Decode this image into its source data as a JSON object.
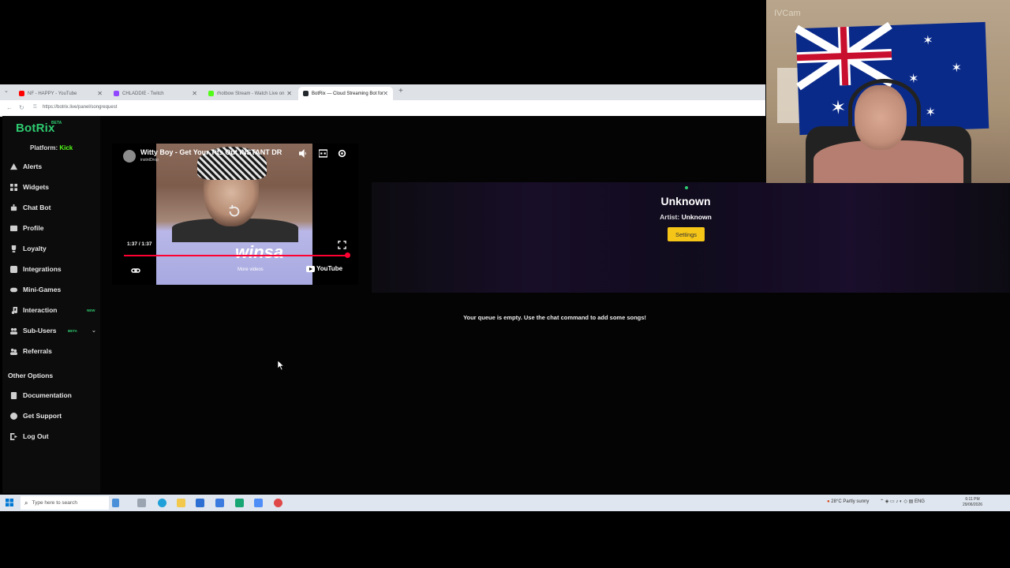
{
  "browser": {
    "tabs": [
      {
        "label": "NF - HAPPY - YouTube",
        "color": "#ff0000"
      },
      {
        "label": "CHLADDIE - Twitch",
        "color": "#9146ff"
      },
      {
        "label": "rhotbow Stream - Watch Live on",
        "color": "#53fc18"
      },
      {
        "label": "BotRix — Cloud Streaming Bot for",
        "color": "#24292e"
      }
    ],
    "url": "https://botrix.live/panel/songrequest",
    "new_tab": "+",
    "close": "✕"
  },
  "sidebar": {
    "logo": "BotRix",
    "beta": "BETA",
    "platform_label": "Platform:",
    "platform_value": "Kick",
    "items": [
      {
        "label": "Alerts",
        "icon": "alert-icon"
      },
      {
        "label": "Widgets",
        "icon": "widgets-icon"
      },
      {
        "label": "Chat Bot",
        "icon": "robot-icon"
      },
      {
        "label": "Profile",
        "icon": "profile-icon"
      },
      {
        "label": "Loyalty",
        "icon": "trophy-icon"
      },
      {
        "label": "Integrations",
        "icon": "integrations-icon"
      },
      {
        "label": "Mini-Games",
        "icon": "gamepad-icon"
      },
      {
        "label": "Interaction",
        "icon": "music-icon",
        "badge": "NEW"
      },
      {
        "label": "Sub-Users",
        "icon": "users-icon",
        "badge": "BETA"
      },
      {
        "label": "Referrals",
        "icon": "referrals-icon"
      }
    ],
    "other_options_title": "Other Options",
    "other_items": [
      {
        "label": "Documentation",
        "icon": "book-icon"
      },
      {
        "label": "Get Support",
        "icon": "help-icon"
      },
      {
        "label": "Log Out",
        "icon": "logout-icon"
      }
    ]
  },
  "player": {
    "title": "Witty Boy - Get Your Tits Out INSTANT DR",
    "channel": "instntDrop",
    "time": "1:37 / 1:37",
    "progress": 1.0,
    "more_videos": "More videos",
    "youtube": "YouTube",
    "thumb_text": "winsa"
  },
  "now_playing": {
    "title": "Unknown",
    "artist_label": "Artist:",
    "artist_value": "Unknown",
    "settings_label": "Settings"
  },
  "queue": {
    "empty_message": "Your queue is empty. Use the chat command to add some songs!"
  },
  "webcam": {
    "label": "IVCam"
  },
  "taskbar": {
    "search_placeholder": "Type here to search",
    "weather": "28°C  Partly sunny",
    "lang": "ENG",
    "time": "6:11 PM",
    "date": "29/06/2026"
  }
}
